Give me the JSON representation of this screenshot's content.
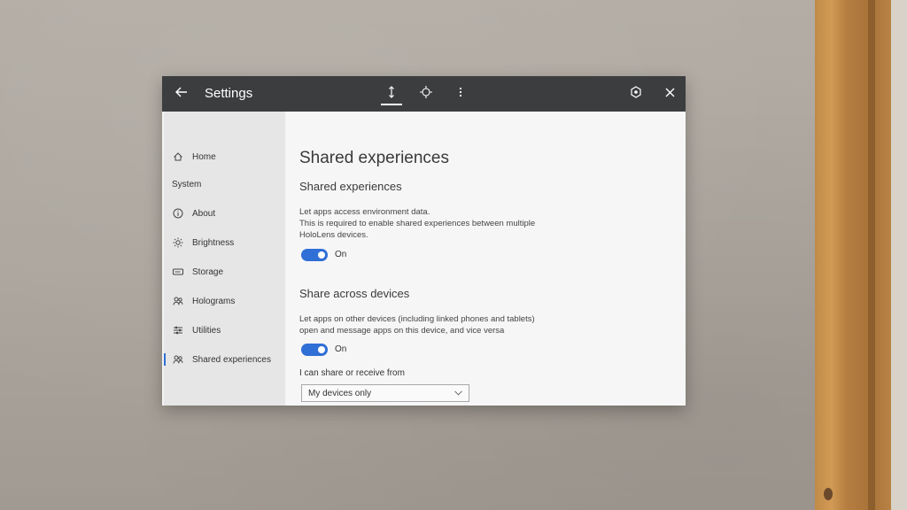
{
  "window": {
    "title": "Settings",
    "titlebar_icons": [
      "back-arrow-icon",
      "adjust-icon",
      "move-icon",
      "more-icon",
      "follow-me-icon",
      "close-icon"
    ]
  },
  "sidebar": {
    "items": [
      {
        "label": "Home",
        "icon": "home-icon"
      },
      {
        "heading": "System"
      },
      {
        "label": "About",
        "icon": "info-icon"
      },
      {
        "label": "Brightness",
        "icon": "brightness-icon"
      },
      {
        "label": "Storage",
        "icon": "storage-icon"
      },
      {
        "label": "Holograms",
        "icon": "holograms-icon"
      },
      {
        "label": "Utilities",
        "icon": "utilities-icon"
      },
      {
        "label": "Shared experiences",
        "icon": "shared-experiences-icon",
        "active": true
      }
    ]
  },
  "main": {
    "page_title": "Shared experiences",
    "section1": {
      "title": "Shared experiences",
      "desc": [
        "Let apps access environment data.",
        "This is required to enable shared experiences between multiple",
        "HoloLens devices."
      ],
      "toggle_label": "On"
    },
    "section2": {
      "title": "Share across devices",
      "desc": [
        "Let apps on other devices (including linked phones and tablets)",
        "open and message apps on this device, and vice versa"
      ],
      "toggle_label": "On",
      "select_label": "I can share or receive from",
      "select_value": "My devices only"
    }
  },
  "colors": {
    "accent": "#2f6fd6",
    "titlebar": "#3c3d3f",
    "sidebar": "#e6e6e6",
    "content": "#f6f6f6"
  }
}
